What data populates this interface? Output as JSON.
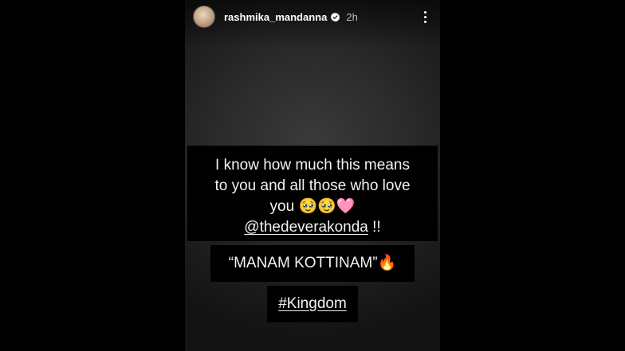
{
  "header": {
    "username": "rashmika_mandanna",
    "time": "2h"
  },
  "story": {
    "line1": "I know how much this means",
    "line2": "to you and all those who love",
    "line3_text": "you",
    "line3_emoji": "🥹🥹🩷",
    "mention": "@thedeverakonda",
    "mention_suffix": " !!",
    "quote": "“MANAM KOTTINAM”🔥",
    "hashtag": "#Kingdom"
  },
  "colors": {
    "background": "#000000",
    "story_bg": "#2a2a2a",
    "text": "#f2f2f2",
    "verified": "#ffffff"
  },
  "icons": {
    "verified": "verified-badge-icon",
    "more": "more-vertical-icon"
  }
}
